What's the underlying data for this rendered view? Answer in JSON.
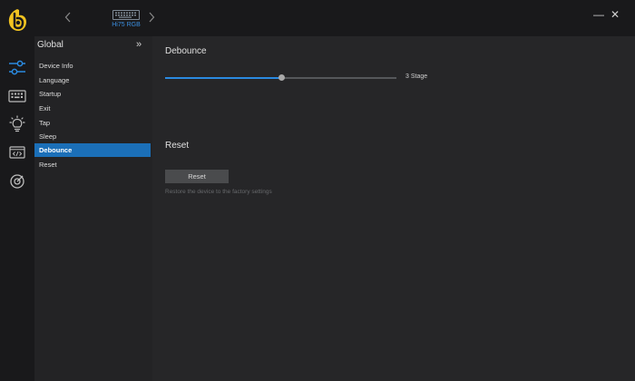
{
  "device": {
    "label": "Hi75 RGB"
  },
  "window": {
    "minimize": "—",
    "close": "✕"
  },
  "rail": {
    "icons": [
      "sliders-icon",
      "keyboard-icon",
      "lightbulb-icon",
      "code-window-icon",
      "target-icon"
    ],
    "accent": "#2a8ae0",
    "logo_color": "#f2c320"
  },
  "menu": {
    "title": "Global",
    "collapse": "»",
    "items": [
      {
        "label": "Device Info",
        "active": false
      },
      {
        "label": "Language",
        "active": false
      },
      {
        "label": "Startup",
        "active": false
      },
      {
        "label": "Exit",
        "active": false
      },
      {
        "label": "Tap",
        "active": false
      },
      {
        "label": "Sleep",
        "active": false
      },
      {
        "label": "Debounce",
        "active": true
      },
      {
        "label": "Reset",
        "active": false
      }
    ]
  },
  "debounce": {
    "title": "Debounce",
    "value_label": "3 Stage",
    "slider_fraction": 0.5
  },
  "reset": {
    "title": "Reset",
    "button_label": "Reset",
    "hint": "Restore the device to the factory settings"
  }
}
